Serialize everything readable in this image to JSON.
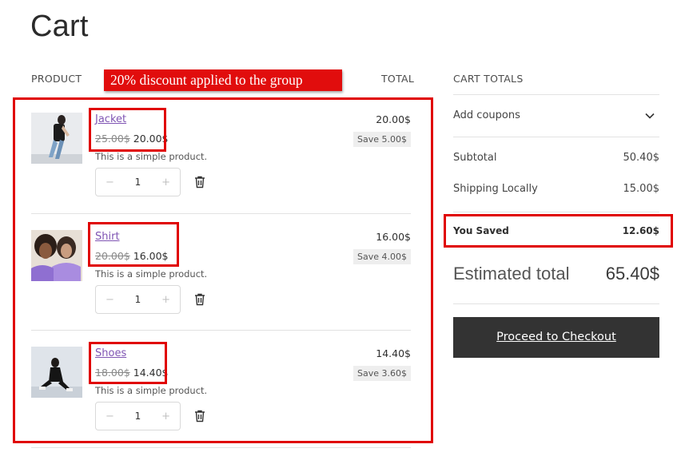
{
  "page": {
    "title": "Cart"
  },
  "table": {
    "product_header": "PRODUCT",
    "total_header": "TOTAL"
  },
  "annotation": {
    "banner_text": "20% discount applied to the group",
    "highlight_color": "#e00000"
  },
  "items": [
    {
      "name": "Jacket",
      "regular_price": "25.00$",
      "sale_price": "20.00$",
      "description": "This is a simple product.",
      "quantity": "1",
      "line_total": "20.00$",
      "savings": "Save 5.00$",
      "image_icon": "jacket-photo"
    },
    {
      "name": "Shirt",
      "regular_price": "20.00$",
      "sale_price": "16.00$",
      "description": "This is a simple product.",
      "quantity": "1",
      "line_total": "16.00$",
      "savings": "Save 4.00$",
      "image_icon": "shirt-photo"
    },
    {
      "name": "Shoes",
      "regular_price": "18.00$",
      "sale_price": "14.40$",
      "description": "This is a simple product.",
      "quantity": "1",
      "line_total": "14.40$",
      "savings": "Save 3.60$",
      "image_icon": "shoes-photo"
    }
  ],
  "qty_controls": {
    "minus": "−",
    "plus": "+"
  },
  "totals": {
    "heading": "CART TOTALS",
    "coupons_label": "Add coupons",
    "subtotal_label": "Subtotal",
    "subtotal_value": "50.40$",
    "shipping_label": "Shipping Locally",
    "shipping_value": "15.00$",
    "saved_label": "You Saved",
    "saved_value": "12.60$",
    "estimated_label": "Estimated total",
    "estimated_value": "65.40$",
    "checkout_label": "Proceed to Checkout"
  },
  "colors": {
    "link": "#7f54b3",
    "button_bg": "#333333",
    "banner_bg": "#e10d0d"
  }
}
